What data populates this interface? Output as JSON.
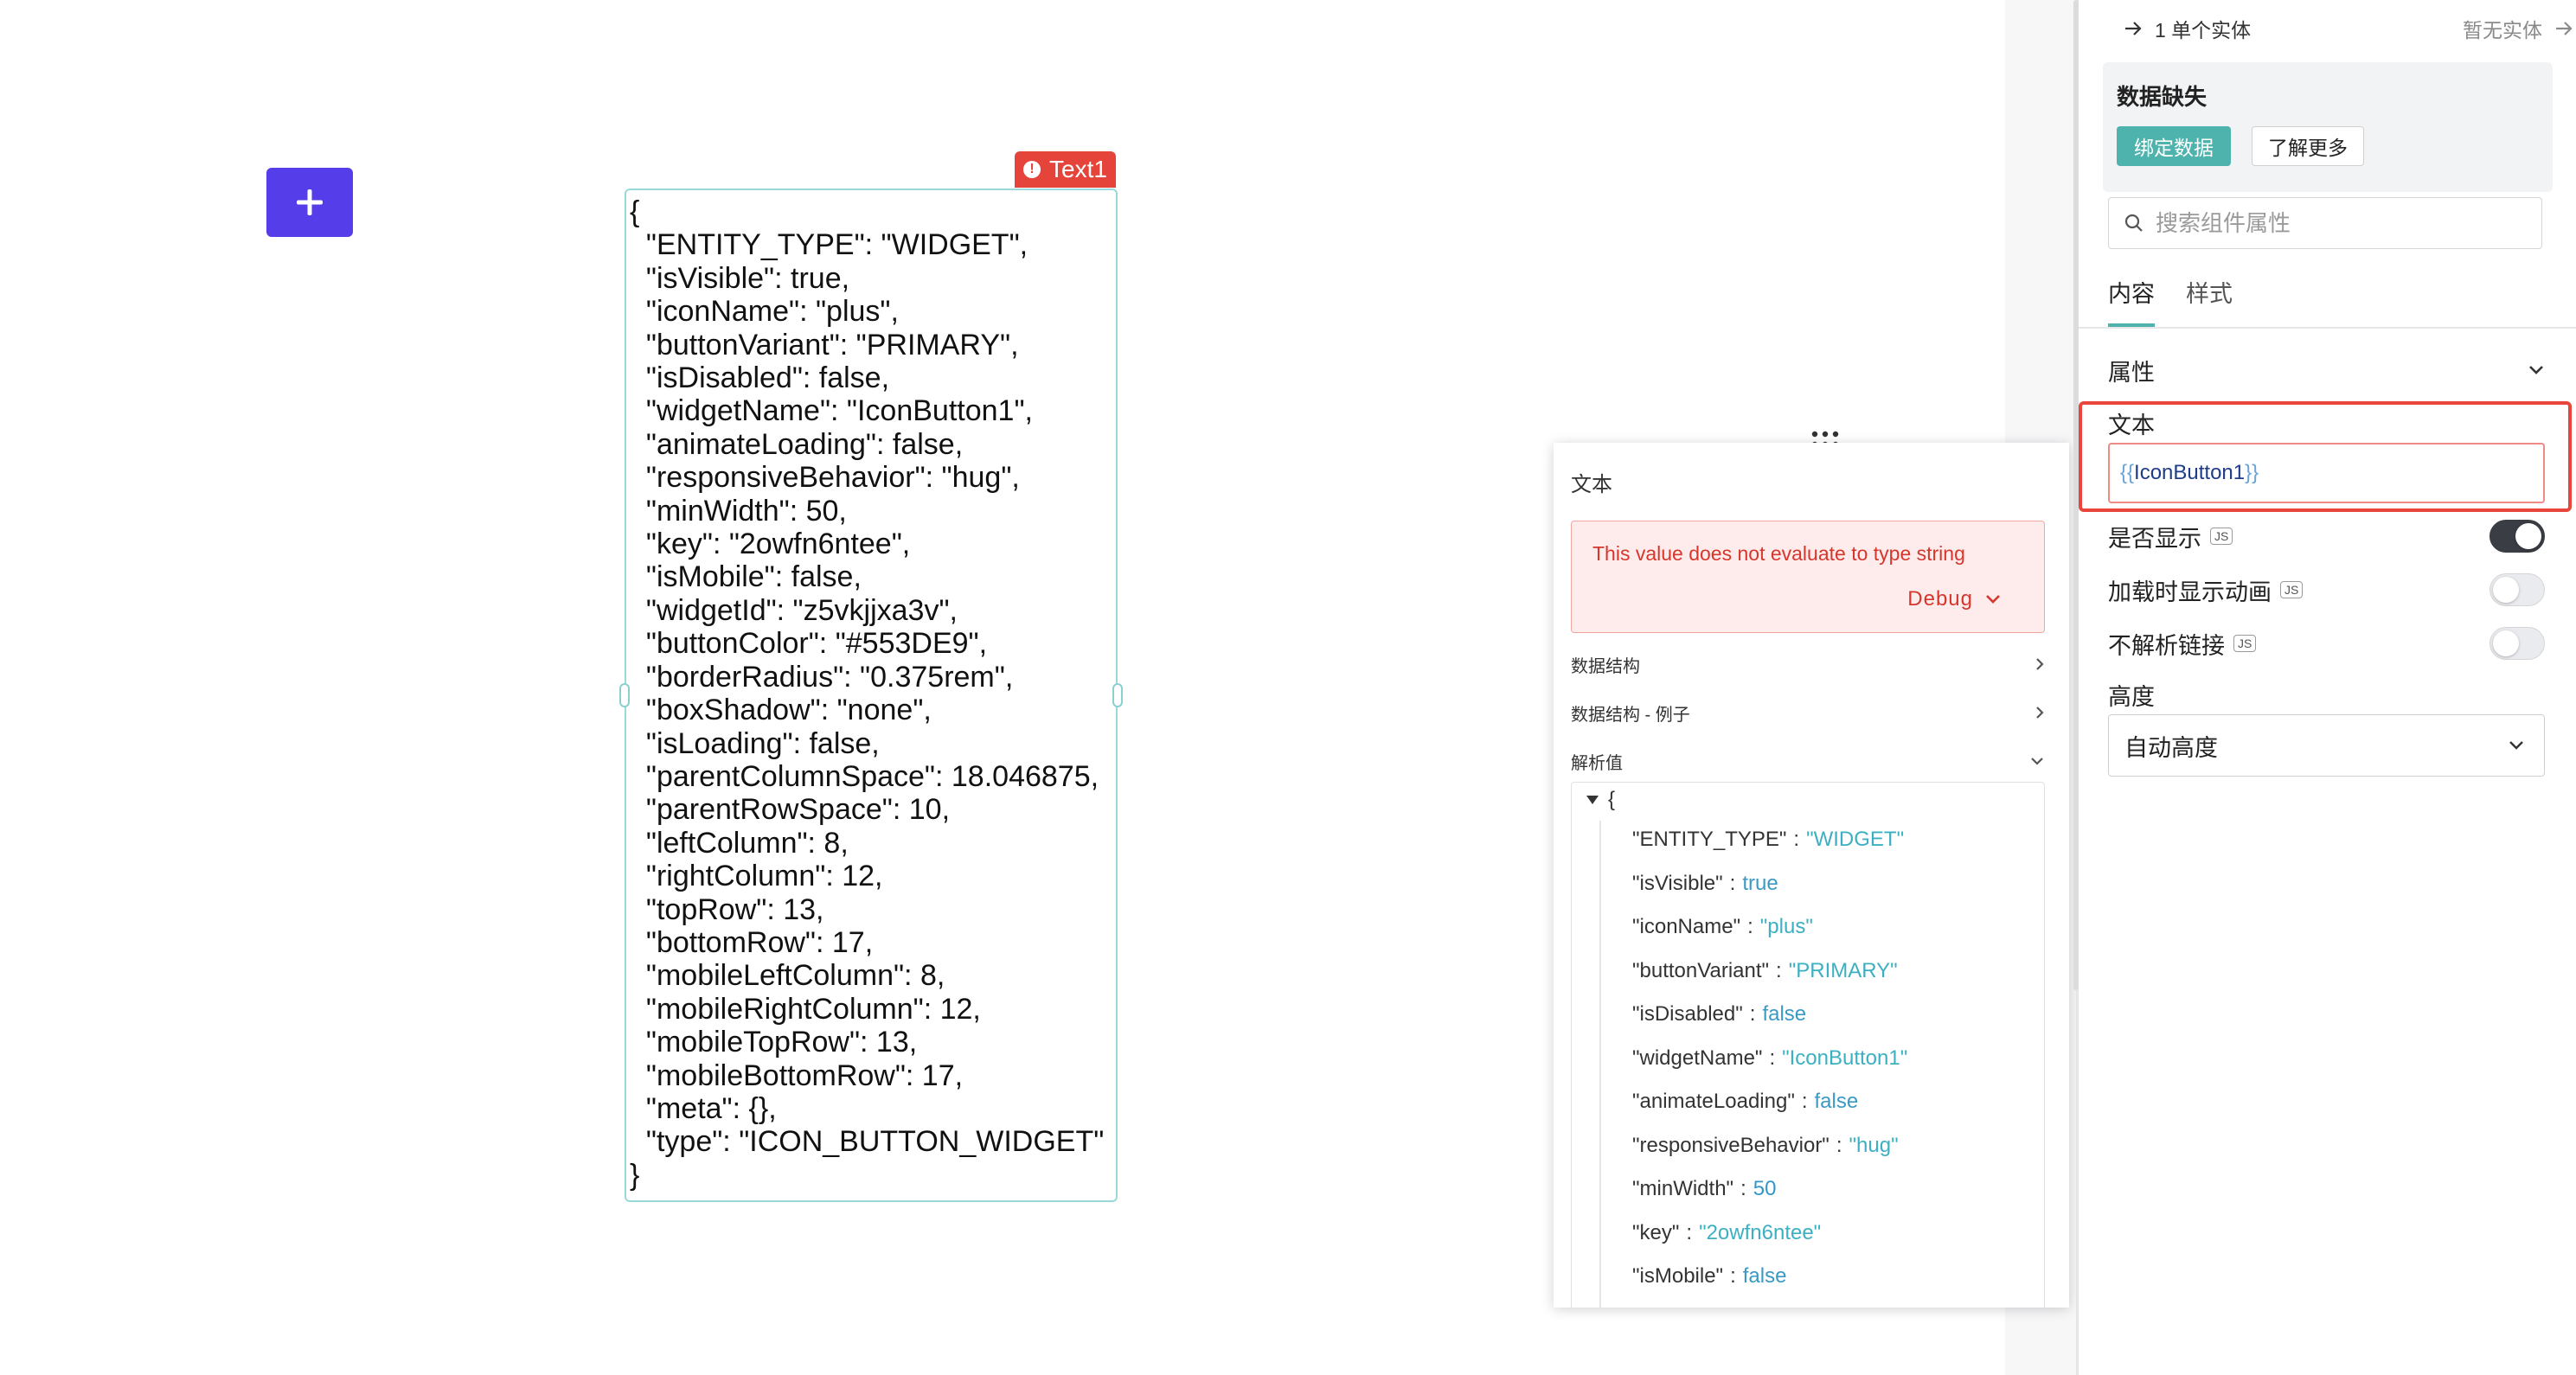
{
  "canvas": {
    "icon_button": {
      "icon": "plus-icon",
      "color": "#553DE9"
    },
    "text_widget": {
      "tag_label": "Text1",
      "tag_color": "#e5443b",
      "content_lines": [
        "{",
        "  \"ENTITY_TYPE\": \"WIDGET\",",
        "  \"isVisible\": true,",
        "  \"iconName\": \"plus\",",
        "  \"buttonVariant\": \"PRIMARY\",",
        "  \"isDisabled\": false,",
        "  \"widgetName\": \"IconButton1\",",
        "  \"animateLoading\": false,",
        "  \"responsiveBehavior\": \"hug\",",
        "  \"minWidth\": 50,",
        "  \"key\": \"2owfn6ntee\",",
        "  \"isMobile\": false,",
        "  \"widgetId\": \"z5vkjjxa3v\",",
        "  \"buttonColor\": \"#553DE9\",",
        "  \"borderRadius\": \"0.375rem\",",
        "  \"boxShadow\": \"none\",",
        "  \"isLoading\": false,",
        "  \"parentColumnSpace\": 18.046875,",
        "  \"parentRowSpace\": 10,",
        "  \"leftColumn\": 8,",
        "  \"rightColumn\": 12,",
        "  \"topRow\": 13,",
        "  \"bottomRow\": 17,",
        "  \"mobileLeftColumn\": 8,",
        "  \"mobileRightColumn\": 12,",
        "  \"mobileTopRow\": 13,",
        "  \"mobileBottomRow\": 17,",
        "  \"meta\": {},",
        "  \"type\": \"ICON_BUTTON_WIDGET\"",
        "}"
      ]
    }
  },
  "eval_popover": {
    "title": "文本",
    "error_message": "This value does not evaluate to type string",
    "debug_label": "Debug",
    "sections": {
      "data_structure": "数据结构",
      "data_structure_example": "数据结构 - 例子",
      "evaluated_value": "解析值"
    },
    "open_brace": "{",
    "entries": [
      {
        "key": "\"ENTITY_TYPE\"",
        "value": "\"WIDGET\"",
        "type": "string"
      },
      {
        "key": "\"isVisible\"",
        "value": "true",
        "type": "bool"
      },
      {
        "key": "\"iconName\"",
        "value": "\"plus\"",
        "type": "string"
      },
      {
        "key": "\"buttonVariant\"",
        "value": "\"PRIMARY\"",
        "type": "string"
      },
      {
        "key": "\"isDisabled\"",
        "value": "false",
        "type": "bool"
      },
      {
        "key": "\"widgetName\"",
        "value": "\"IconButton1\"",
        "type": "string"
      },
      {
        "key": "\"animateLoading\"",
        "value": "false",
        "type": "bool"
      },
      {
        "key": "\"responsiveBehavior\"",
        "value": "\"hug\"",
        "type": "string"
      },
      {
        "key": "\"minWidth\"",
        "value": "50",
        "type": "num"
      },
      {
        "key": "\"key\"",
        "value": "\"2owfn6ntee\"",
        "type": "string"
      },
      {
        "key": "\"isMobile\"",
        "value": "false",
        "type": "bool"
      }
    ]
  },
  "property_pane": {
    "entity_left": "1 单个实体",
    "entity_right": "暂无实体",
    "missing_title": "数据缺失",
    "bind_button": "绑定数据",
    "learn_more_button": "了解更多",
    "search_placeholder": "搜索组件属性",
    "tabs": [
      "内容",
      "样式"
    ],
    "section_title": "属性",
    "text_label": "文本",
    "text_value": {
      "open": "{{",
      "binding": "IconButton1",
      "close": "}}"
    },
    "toggles": [
      {
        "label": "是否显示",
        "badge": "JS",
        "on": true
      },
      {
        "label": "加载时显示动画",
        "badge": "JS",
        "on": false
      },
      {
        "label": "不解析链接",
        "badge": "JS",
        "on": false
      }
    ],
    "height_label": "高度",
    "height_value": "自动高度",
    "accent_color": "#4fb3ad",
    "error_color": "#e8453c"
  }
}
